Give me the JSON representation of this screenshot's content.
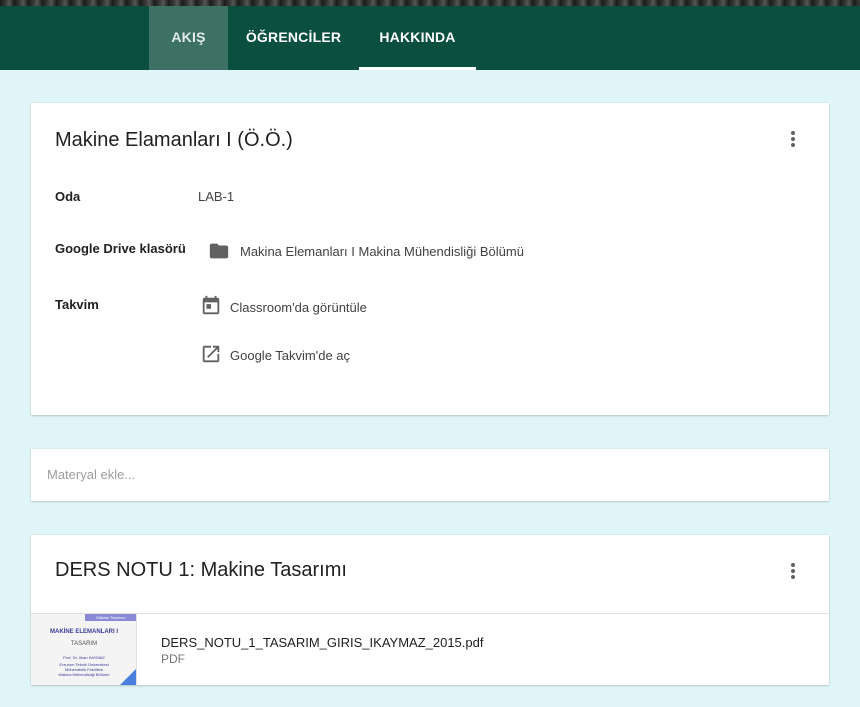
{
  "nav": {
    "tabs": [
      {
        "label": "AKIŞ"
      },
      {
        "label": "ÖĞRENCİLER"
      },
      {
        "label": "HAKKINDA"
      }
    ],
    "active_tab": "HAKKINDA"
  },
  "about": {
    "title": "Makine Elamanları I (Ö.Ö.)",
    "room": {
      "label": "Oda",
      "value": "LAB-1"
    },
    "drive": {
      "label": "Google Drive klasörü",
      "value": "Makina Elemanları I Makina Mühendisliği Bölümü"
    },
    "calendar": {
      "label": "Takvim",
      "view_in_classroom": "Classroom'da görüntüle",
      "open_google_calendar": "Google Takvim'de aç"
    }
  },
  "material": {
    "placeholder": "Materyal ekle..."
  },
  "ders": {
    "title": "DERS NOTU 1: Makine Tasarımı",
    "attachment": {
      "file_name": "DERS_NOTU_1_TASARIM_GIRIS_IKAYMAZ_2015.pdf",
      "file_type": "PDF",
      "thumbnail": {
        "header": "Makine Tasarımı",
        "title": "MAKİNE ELEMANLARI I",
        "subtitle": "TASARIM",
        "author": "Prof. Dr. İlhan KAYMAZ",
        "line1": "Erzurum Teknik Üniversitesi",
        "line2": "Mühendislik Fakültesi",
        "line3": "Makina Mühendisliği Bölümü"
      }
    }
  },
  "colors": {
    "navbar": "#0b4f3f",
    "active_tab_bg": "#3c7164",
    "page_bg": "#e0f5f7",
    "icon": "#616161"
  }
}
